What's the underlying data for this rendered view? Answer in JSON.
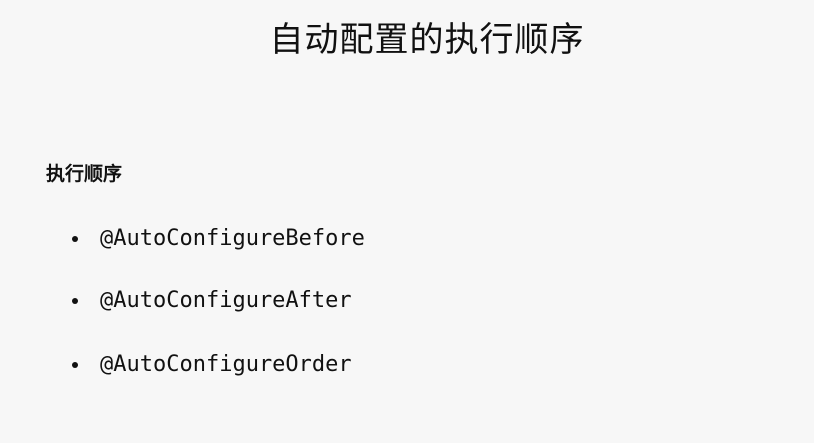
{
  "slide": {
    "title": "自动配置的执行顺序",
    "section_heading": "执行顺序",
    "bullets": [
      "@AutoConfigureBefore",
      "@AutoConfigureAfter",
      "@AutoConfigureOrder"
    ]
  }
}
